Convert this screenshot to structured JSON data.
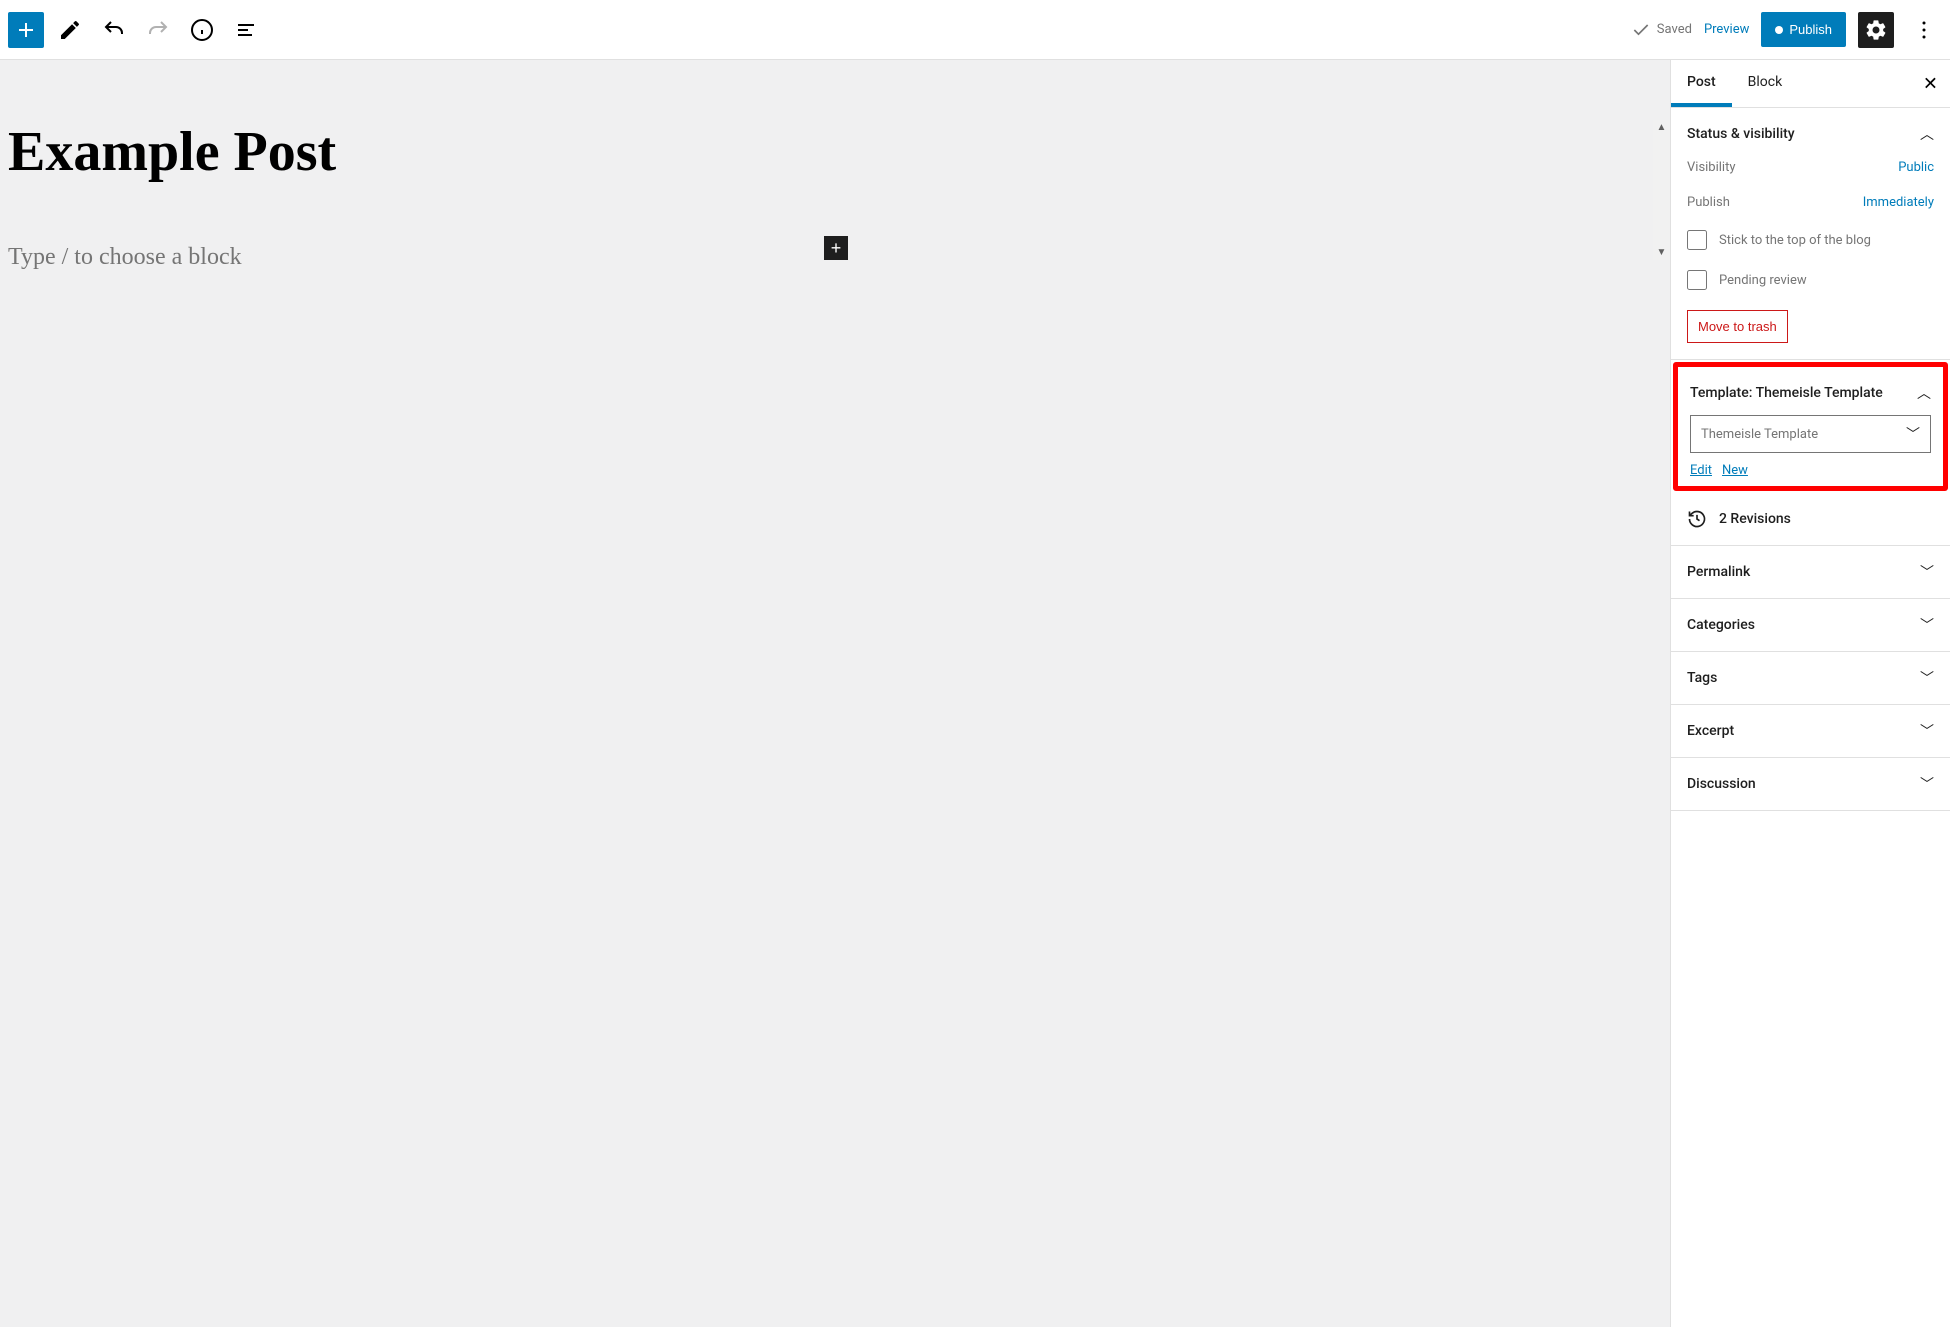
{
  "topbar": {
    "saved_label": "Saved",
    "preview_label": "Preview",
    "publish_label": "Publish"
  },
  "editor": {
    "title": "Example Post",
    "placeholder": "Type / to choose a block"
  },
  "sidebar": {
    "tabs": {
      "post": "Post",
      "block": "Block"
    },
    "status_panel": {
      "title": "Status & visibility",
      "visibility_label": "Visibility",
      "visibility_value": "Public",
      "publish_label": "Publish",
      "publish_value": "Immediately",
      "stick_label": "Stick to the top of the blog",
      "pending_label": "Pending review",
      "trash_label": "Move to trash"
    },
    "template_panel": {
      "title": "Template: Themeisle Template",
      "selected": "Themeisle Template",
      "edit_label": "Edit",
      "new_label": "New"
    },
    "revisions": {
      "label": "2 Revisions"
    },
    "permalink": {
      "title": "Permalink"
    },
    "categories": {
      "title": "Categories"
    },
    "tags": {
      "title": "Tags"
    },
    "excerpt": {
      "title": "Excerpt"
    },
    "discussion": {
      "title": "Discussion"
    }
  }
}
